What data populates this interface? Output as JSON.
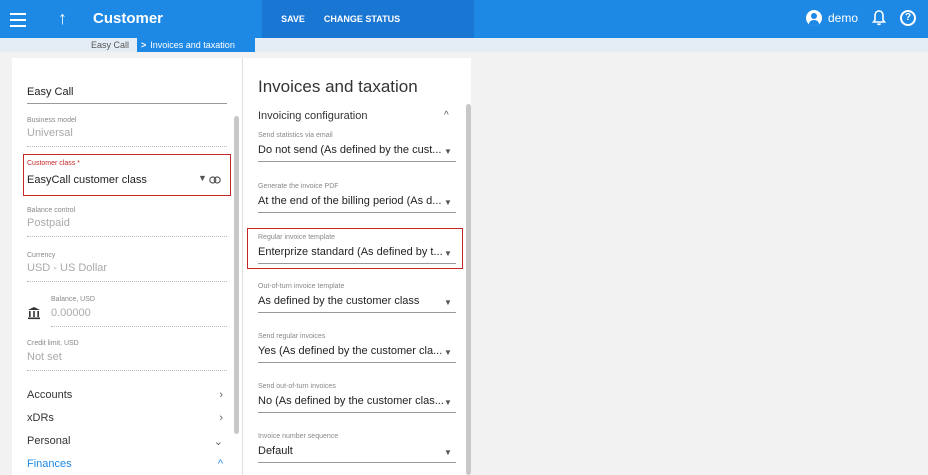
{
  "header": {
    "title": "Customer",
    "save_label": "SAVE",
    "change_status_label": "CHANGE STATUS",
    "user_name": "demo"
  },
  "breadcrumb": {
    "parent": "Easy Call",
    "current": "Invoices and taxation"
  },
  "left_panel": {
    "customer_name": "Easy Call",
    "business_model": {
      "label": "Business model",
      "value": "Universal"
    },
    "customer_class": {
      "label": "Customer class *",
      "value": "EasyCall customer class"
    },
    "balance_control": {
      "label": "Balance control",
      "value": "Postpaid"
    },
    "currency": {
      "label": "Currency",
      "value": "USD - US Dollar"
    },
    "balance": {
      "label": "Balance, USD",
      "value": "0.00000"
    },
    "credit_limit": {
      "label": "Credit limit, USD",
      "value": "Not set"
    },
    "menu": [
      {
        "label": "Accounts",
        "arrow": "›"
      },
      {
        "label": "xDRs",
        "arrow": "›"
      },
      {
        "label": "Personal",
        "arrow": "⌄"
      },
      {
        "label": "Finances",
        "arrow": "^"
      }
    ]
  },
  "middle_panel": {
    "title": "Invoices and taxation",
    "section": "Invoicing configuration",
    "fields": [
      {
        "label": "Send statistics via email",
        "value": "Do not send (As defined by the cust..."
      },
      {
        "label": "Generate the invoice PDF",
        "value": "At the end of the billing period (As d..."
      },
      {
        "label": "Regular invoice template",
        "value": "Enterprize standard (As defined by t..."
      },
      {
        "label": "Out-of-turn invoice template",
        "value": "As defined by the customer class"
      },
      {
        "label": "Send regular invoices",
        "value": "Yes (As defined by the customer cla..."
      },
      {
        "label": "Send out-of-turn invoices",
        "value": "No (As defined by the customer clas..."
      },
      {
        "label": "Invoice number sequence",
        "value": "Default"
      }
    ]
  },
  "colors": {
    "header": "#1e88e5",
    "highlight": "#c62828",
    "active": "#1e88e5"
  }
}
